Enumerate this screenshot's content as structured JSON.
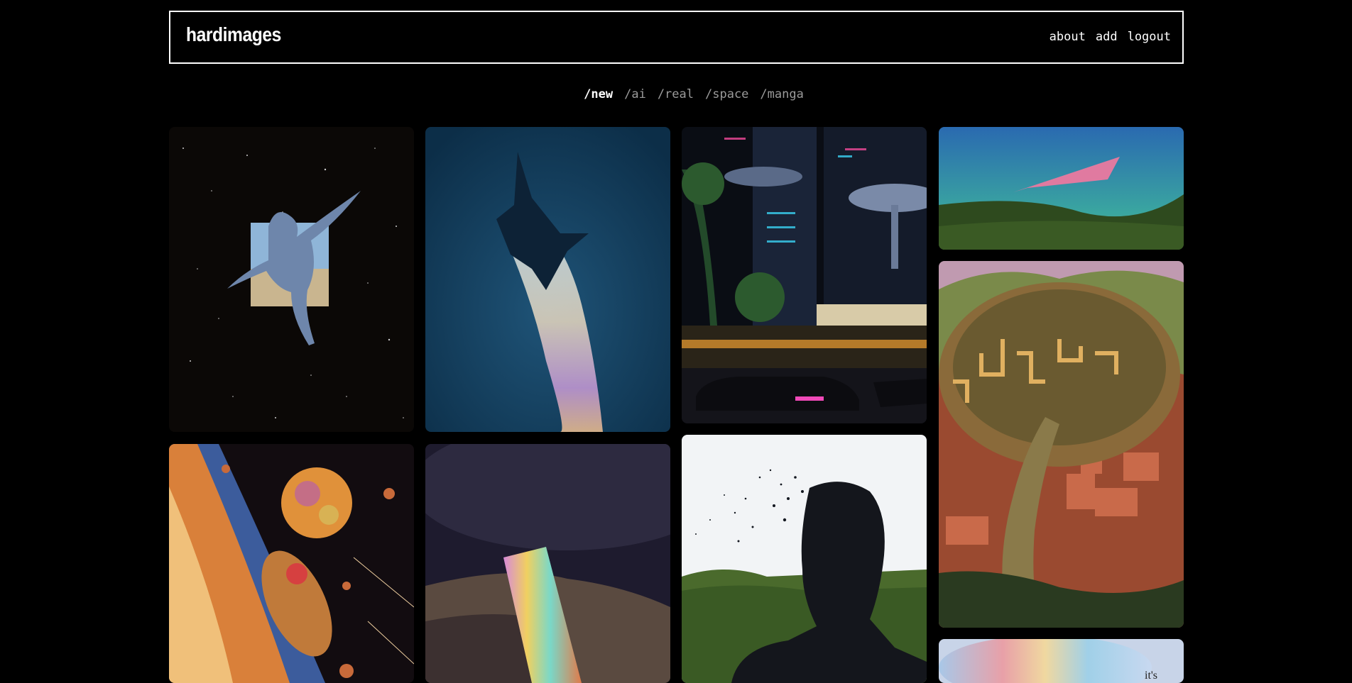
{
  "brand": {
    "name": "hardimages"
  },
  "topnav": {
    "about": "about",
    "add": "add",
    "logout": "logout"
  },
  "categories": [
    {
      "label": "/new",
      "active": true
    },
    {
      "label": "/ai",
      "active": false
    },
    {
      "label": "/real",
      "active": false
    },
    {
      "label": "/space",
      "active": false
    },
    {
      "label": "/manga",
      "active": false
    }
  ],
  "gallery": {
    "images": [
      {
        "subject": "marble statue falling in starfield"
      },
      {
        "subject": "jet with iridescent smoke trail"
      },
      {
        "subject": "retro futuristic neon city with palm trees"
      },
      {
        "subject": "pink floating plane over green hills"
      },
      {
        "subject": "cosmic astronaut near orange planet"
      },
      {
        "subject": "holographic prism on mountain under storm clouds"
      },
      {
        "subject": "dissolving silhouette head into birds"
      },
      {
        "subject": "maze tree over red village"
      },
      {
        "subject": "iridescent cloud with text",
        "visible_text": "it's"
      }
    ]
  },
  "colors": {
    "background": "#000000",
    "text": "#ffffff",
    "muted": "#9a9a9a"
  }
}
